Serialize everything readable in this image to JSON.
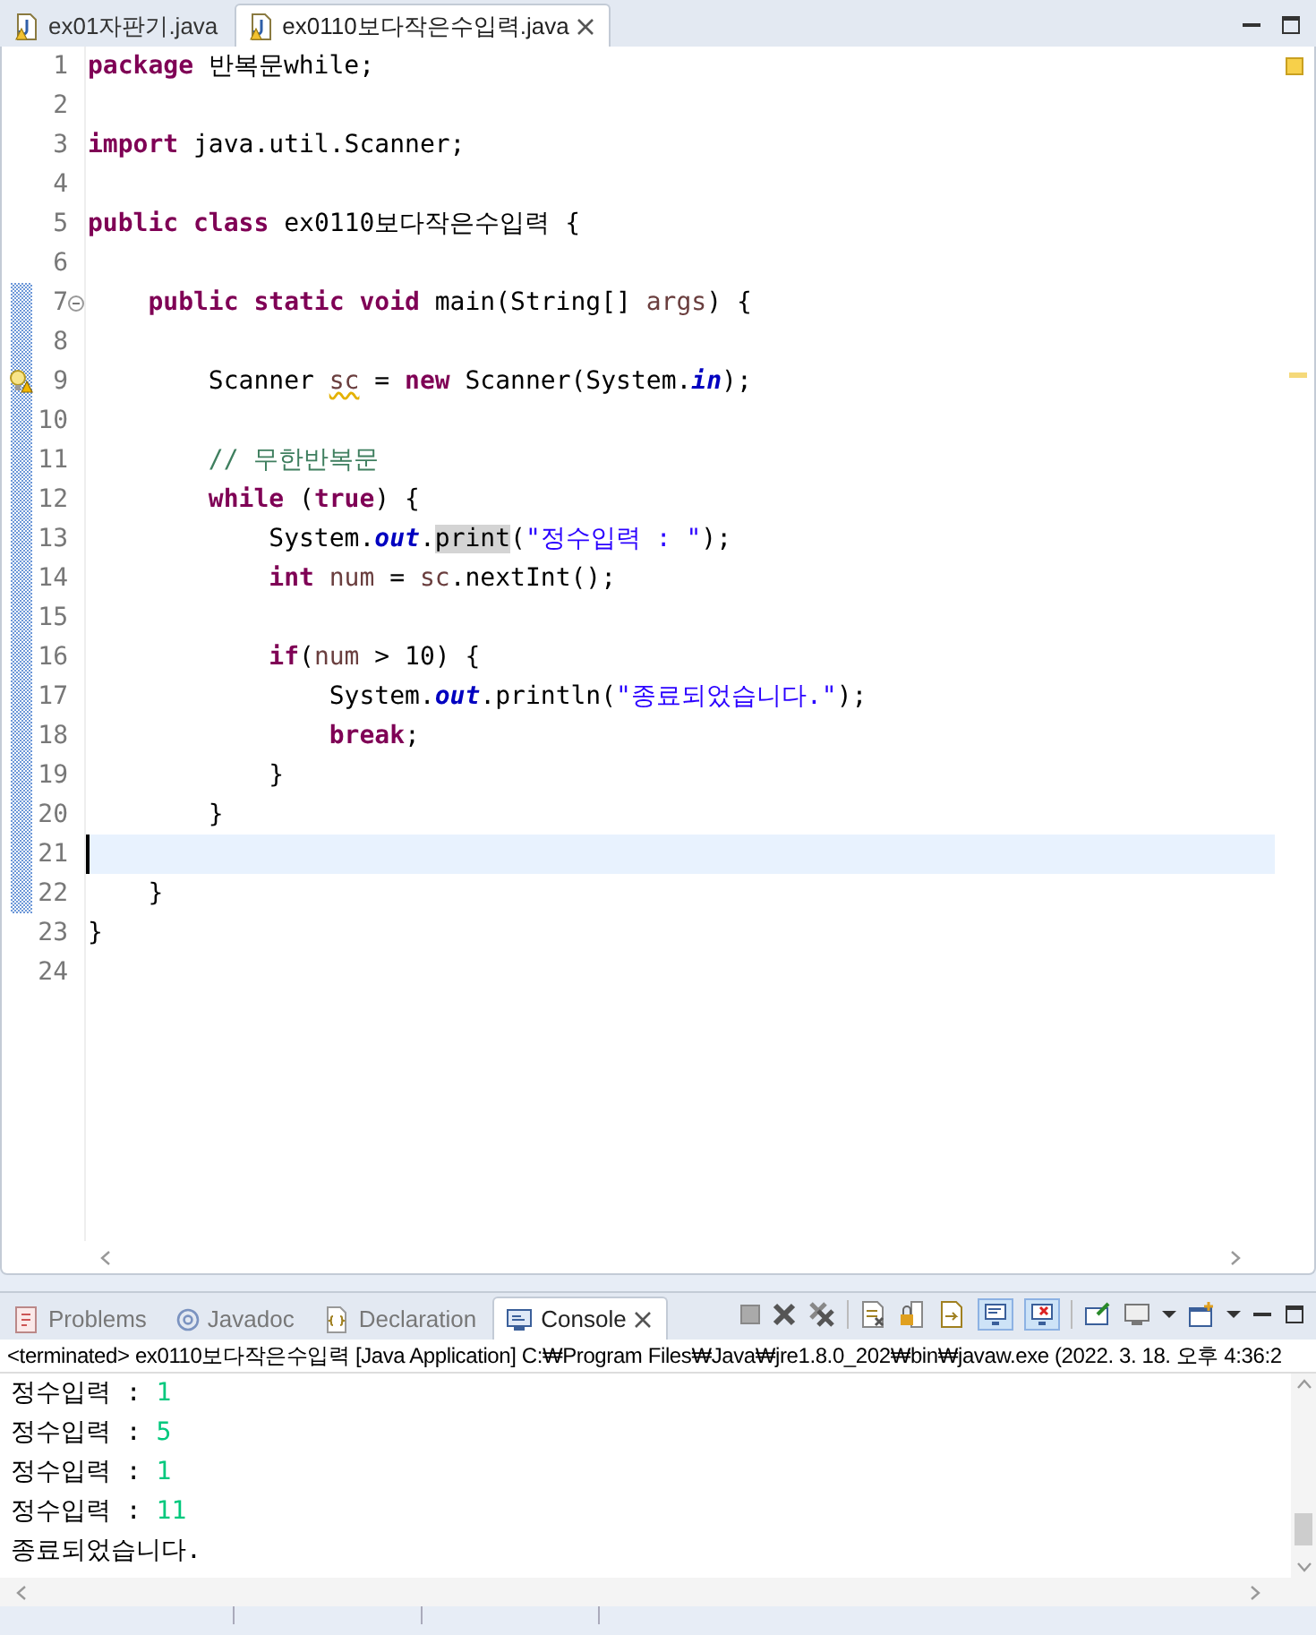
{
  "editor": {
    "tabs": [
      {
        "label": "ex01자판기.java",
        "selected": false
      },
      {
        "label": "ex0110보다작은수입력.java",
        "selected": true
      }
    ],
    "lines": [
      {
        "number": "1",
        "in_range": false,
        "current": false,
        "foldable": false,
        "warning": false,
        "tokens": [
          {
            "kind": "kw",
            "text": "package"
          },
          {
            "kind": "plain",
            "text": " 반복문while;"
          }
        ]
      },
      {
        "number": "2",
        "in_range": false,
        "current": false,
        "foldable": false,
        "warning": false
      },
      {
        "number": "3",
        "in_range": false,
        "current": false,
        "foldable": false,
        "warning": false,
        "tokens": [
          {
            "kind": "kw",
            "text": "import"
          },
          {
            "kind": "plain",
            "text": " java.util.Scanner;"
          }
        ]
      },
      {
        "number": "4",
        "in_range": false,
        "current": false,
        "foldable": false,
        "warning": false
      },
      {
        "number": "5",
        "in_range": false,
        "current": false,
        "foldable": false,
        "warning": false,
        "tokens": [
          {
            "kind": "kw",
            "text": "public class"
          },
          {
            "kind": "plain",
            "text": " ex0110보다작은수입력 {"
          }
        ]
      },
      {
        "number": "6",
        "in_range": false,
        "current": false,
        "foldable": false,
        "warning": false
      },
      {
        "number": "7",
        "in_range": true,
        "current": false,
        "foldable": true,
        "warning": false,
        "tokens": [
          {
            "kind": "kw",
            "text": "    public static void"
          },
          {
            "kind": "plain",
            "text": " main(String[] "
          },
          {
            "kind": "var",
            "text": "args"
          },
          {
            "kind": "plain",
            "text": ") {"
          }
        ]
      },
      {
        "number": "8",
        "in_range": true,
        "current": false,
        "foldable": false,
        "warning": false
      },
      {
        "number": "9",
        "in_range": true,
        "current": false,
        "foldable": false,
        "warning": true,
        "tokens": [
          {
            "kind": "plain",
            "text": "        Scanner "
          },
          {
            "kind": "var_warning",
            "text": "sc"
          },
          {
            "kind": "plain",
            "text": " = "
          },
          {
            "kind": "kw",
            "text": "new"
          },
          {
            "kind": "plain",
            "text": " Scanner(System."
          },
          {
            "kind": "field",
            "text": "in"
          },
          {
            "kind": "plain",
            "text": ");"
          }
        ]
      },
      {
        "number": "10",
        "in_range": true,
        "current": false,
        "foldable": false,
        "warning": false
      },
      {
        "number": "11",
        "in_range": true,
        "current": false,
        "foldable": false,
        "warning": false,
        "tokens": [
          {
            "kind": "comment",
            "text": "        // 무한반복문"
          }
        ]
      },
      {
        "number": "12",
        "in_range": true,
        "current": false,
        "foldable": false,
        "warning": false,
        "tokens": [
          {
            "kind": "kw",
            "text": "        while"
          },
          {
            "kind": "plain",
            "text": " ("
          },
          {
            "kind": "kw",
            "text": "true"
          },
          {
            "kind": "plain",
            "text": ") {"
          }
        ]
      },
      {
        "number": "13",
        "in_range": true,
        "current": false,
        "foldable": false,
        "warning": false,
        "tokens": [
          {
            "kind": "plain",
            "text": "            System."
          },
          {
            "kind": "field",
            "text": "out"
          },
          {
            "kind": "plain",
            "text": "."
          },
          {
            "kind": "occurrence",
            "text": "print"
          },
          {
            "kind": "plain",
            "text": "("
          },
          {
            "kind": "str",
            "text": "\"정수입력 : \""
          },
          {
            "kind": "plain",
            "text": ");"
          }
        ]
      },
      {
        "number": "14",
        "in_range": true,
        "current": false,
        "foldable": false,
        "warning": false,
        "tokens": [
          {
            "kind": "kw",
            "text": "            int"
          },
          {
            "kind": "var",
            "text": " num"
          },
          {
            "kind": "plain",
            "text": " = "
          },
          {
            "kind": "var",
            "text": "sc"
          },
          {
            "kind": "plain",
            "text": ".nextInt();"
          }
        ]
      },
      {
        "number": "15",
        "in_range": true,
        "current": false,
        "foldable": false,
        "warning": false
      },
      {
        "number": "16",
        "in_range": true,
        "current": false,
        "foldable": false,
        "warning": false,
        "tokens": [
          {
            "kind": "kw",
            "text": "            if"
          },
          {
            "kind": "plain",
            "text": "("
          },
          {
            "kind": "var",
            "text": "num"
          },
          {
            "kind": "plain",
            "text": " > 10) {"
          }
        ]
      },
      {
        "number": "17",
        "in_range": true,
        "current": false,
        "foldable": false,
        "warning": false,
        "tokens": [
          {
            "kind": "plain",
            "text": "                System."
          },
          {
            "kind": "field",
            "text": "out"
          },
          {
            "kind": "plain",
            "text": ".println("
          },
          {
            "kind": "str",
            "text": "\"종료되었습니다.\""
          },
          {
            "kind": "plain",
            "text": ");"
          }
        ]
      },
      {
        "number": "18",
        "in_range": true,
        "current": false,
        "foldable": false,
        "warning": false,
        "tokens": [
          {
            "kind": "kw",
            "text": "                break"
          },
          {
            "kind": "plain",
            "text": ";"
          }
        ]
      },
      {
        "number": "19",
        "in_range": true,
        "current": false,
        "foldable": false,
        "warning": false,
        "tokens": [
          {
            "kind": "plain",
            "text": "            }"
          }
        ]
      },
      {
        "number": "20",
        "in_range": true,
        "current": false,
        "foldable": false,
        "warning": false,
        "tokens": [
          {
            "kind": "plain",
            "text": "        }"
          }
        ]
      },
      {
        "number": "21",
        "in_range": true,
        "current": true,
        "foldable": false,
        "warning": false
      },
      {
        "number": "22",
        "in_range": true,
        "current": false,
        "foldable": false,
        "warning": false,
        "tokens": [
          {
            "kind": "plain",
            "text": "    }"
          }
        ]
      },
      {
        "number": "23",
        "in_range": false,
        "current": false,
        "foldable": false,
        "warning": false,
        "tokens": [
          {
            "kind": "plain",
            "text": "}"
          }
        ]
      },
      {
        "number": "24",
        "in_range": false,
        "current": false,
        "foldable": false,
        "warning": false
      }
    ]
  },
  "console": {
    "tabs": [
      {
        "label": "Problems",
        "kind": "problems",
        "selected": false
      },
      {
        "label": "Javadoc",
        "kind": "javadoc",
        "selected": false
      },
      {
        "label": "Declaration",
        "kind": "declaration",
        "selected": false
      },
      {
        "label": "Console",
        "kind": "console",
        "selected": true
      }
    ],
    "toolbar_toggles": [
      {
        "selected": true
      },
      {
        "selected": true
      }
    ],
    "status": "<terminated> ex0110보다작은수입력 [Java Application] C:₩Program Files₩Java₩jre1.8.0_202₩bin₩javaw.exe (2022. 3. 18. 오후 4:36:2",
    "output": [
      {
        "prompt": "정수입력 : ",
        "input": "1"
      },
      {
        "prompt": "정수입력 : ",
        "input": "5"
      },
      {
        "prompt": "정수입력 : ",
        "input": "1"
      },
      {
        "prompt": "정수입력 : ",
        "input": "11"
      },
      {
        "prompt": "종료되었습니다."
      }
    ]
  }
}
